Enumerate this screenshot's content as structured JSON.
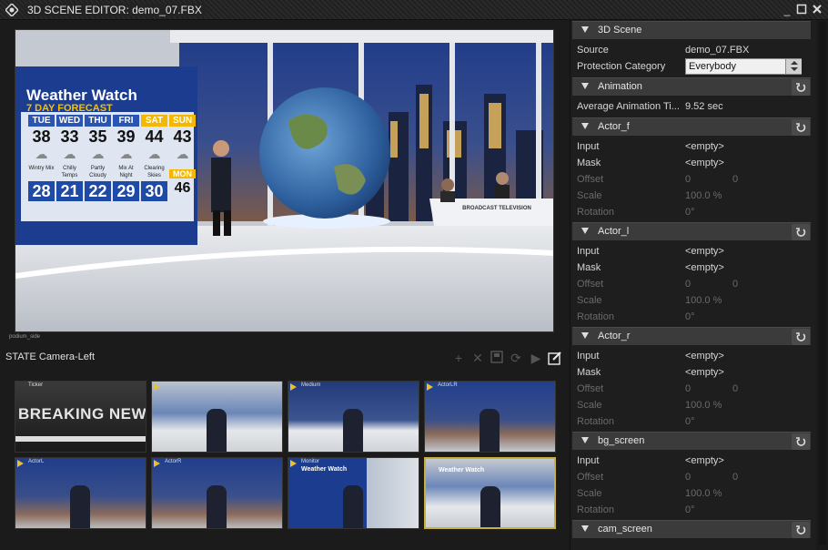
{
  "window": {
    "title": "3D SCENE EDITOR: demo_07.FBX"
  },
  "viewport": {
    "label": "podium_side",
    "weather": {
      "title": "Weather Watch",
      "subtitle": "7 DAY FORECAST",
      "days": [
        {
          "day": "TUE",
          "high": "38",
          "cond": "Wintry Mix",
          "low": "28"
        },
        {
          "day": "WED",
          "high": "33",
          "cond": "Chilly Temps",
          "low": "21"
        },
        {
          "day": "THU",
          "high": "35",
          "cond": "Partly Cloudy",
          "low": "22"
        },
        {
          "day": "FRI",
          "high": "39",
          "cond": "Mix At Night",
          "low": "29"
        },
        {
          "day": "SAT",
          "high": "44",
          "cond": "Clearing Skies",
          "low": "30"
        },
        {
          "day": "SUN",
          "high": "43",
          "cond": "",
          "low": ""
        }
      ],
      "extra_day": "MON",
      "extra_high": "46"
    },
    "desk_text": "BROADCAST TELEVISION"
  },
  "state": {
    "title": "STATE Camera-Left",
    "tools": [
      "add-icon",
      "delete-icon",
      "save-icon",
      "refresh-icon",
      "play-icon",
      "edit-icon"
    ]
  },
  "thumbnails": [
    {
      "label": "Ticker",
      "overlay": "BREAKING NEWS",
      "kind": "breaking"
    },
    {
      "label": "",
      "overlay": "",
      "kind": "studio-wide"
    },
    {
      "label": "Medium",
      "overlay": "",
      "kind": "desk"
    },
    {
      "label": "ActorLR",
      "overlay": "",
      "kind": "two-actors"
    },
    {
      "label": "ActorL",
      "overlay": "",
      "kind": "actor-female"
    },
    {
      "label": "ActorR",
      "overlay": "",
      "kind": "actor-male"
    },
    {
      "label": "Monitor",
      "overlay": "Weather Watch",
      "kind": "weather"
    },
    {
      "label": "",
      "overlay": "Weather Watch",
      "kind": "wide-weather"
    }
  ],
  "panel": {
    "sections": [
      {
        "title": "3D Scene",
        "reset": false
      },
      {
        "title": "Animation",
        "reset": true
      },
      {
        "title": "Actor_f",
        "reset": true
      },
      {
        "title": "Actor_l",
        "reset": true
      },
      {
        "title": "Actor_r",
        "reset": true
      },
      {
        "title": "bg_screen",
        "reset": true
      },
      {
        "title": "cam_screen",
        "reset": true
      }
    ],
    "scene": {
      "source_label": "Source",
      "source_value": "demo_07.FBX",
      "protection_label": "Protection Category",
      "protection_value": "Everybody"
    },
    "animation": {
      "label": "Average Animation Ti...",
      "value": "9.52 sec"
    },
    "actor_rows": {
      "input": "Input",
      "mask": "Mask",
      "offset": "Offset",
      "scale": "Scale",
      "rotation": "Rotation",
      "empty": "<empty>",
      "zero": "0",
      "scale_value": "100.0 %",
      "rot_value": "0°"
    }
  },
  "colors": {
    "accent_selected": "#c8b040",
    "panel_header": "#3b3b3b"
  }
}
